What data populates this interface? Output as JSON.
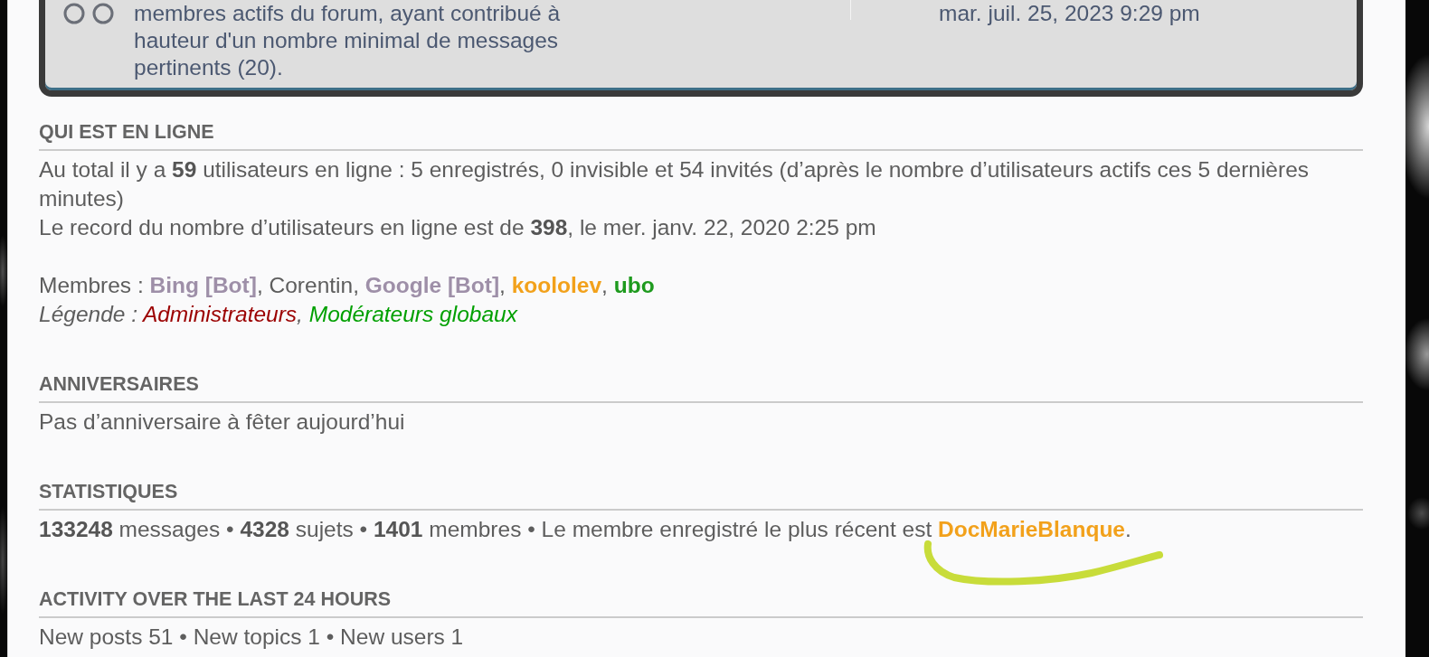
{
  "top_panel": {
    "description": "membres actifs du forum, ayant contribué à hauteur d'un nombre minimal de messages pertinents (20).",
    "date": "mar. juil. 25, 2023 9:29 pm"
  },
  "sections": [
    {
      "title": "QUI EST EN LIGNE",
      "lines": [
        {
          "kind": "text",
          "text": "Au total il y a **59** utilisateurs en ligne : 5 enregistrés, 0 invisible et 54 invités (d’après le nombre d’utilisateurs actifs ces 5 dernières minutes)"
        },
        {
          "kind": "text",
          "text": "Le record du nombre d’utilisateurs en ligne est de **398**, le mer. janv. 22, 2020 2:25 pm"
        },
        {
          "kind": "members",
          "parts": [
            {
              "kind": "text",
              "text": "Membres : "
            },
            {
              "kind": "link",
              "text": "Bing [Bot]",
              "color": "#9e8fa8"
            },
            {
              "kind": "text",
              "text": ", "
            },
            {
              "kind": "link",
              "text": "Corentin"
            },
            {
              "kind": "text",
              "text": ", "
            },
            {
              "kind": "link",
              "text": "Google [Bot]",
              "color": "#9e8fa8"
            },
            {
              "kind": "text",
              "text": ", "
            },
            {
              "kind": "link",
              "text": "koololev",
              "color": "#f2a11b"
            },
            {
              "kind": "text",
              "text": ", "
            },
            {
              "kind": "link",
              "text": "ubo",
              "color": "#1e9a1e"
            }
          ]
        },
        {
          "kind": "legend",
          "label": "Légende : ",
          "groups": [
            {
              "name": "Administrateurs",
              "color": "#9b0000",
              "after": ", "
            },
            {
              "name": "Modérateurs globaux",
              "color": "#00a000"
            }
          ]
        }
      ]
    },
    {
      "title": "ANNIVERSAIRES",
      "lines": [
        {
          "kind": "text",
          "text": "Pas d’anniversaire à fêter aujourd’hui"
        }
      ]
    },
    {
      "title": "STATISTIQUES",
      "lines": [
        {
          "kind": "stats",
          "parts": [
            {
              "kind": "text",
              "text": "**133248** messages • **4328** sujets • **1401** membres • Le membre enregistré le plus récent est "
            },
            {
              "kind": "link",
              "text": "DocMarieBlanque",
              "color": "#f2a11b",
              "hand_underline": true
            },
            {
              "kind": "text",
              "text": "."
            }
          ]
        }
      ]
    },
    {
      "title": "ACTIVITY OVER THE LAST 24 HOURS",
      "lines": [
        {
          "kind": "text",
          "text": "New posts 51 • New topics 1 • New users 1"
        }
      ]
    }
  ]
}
